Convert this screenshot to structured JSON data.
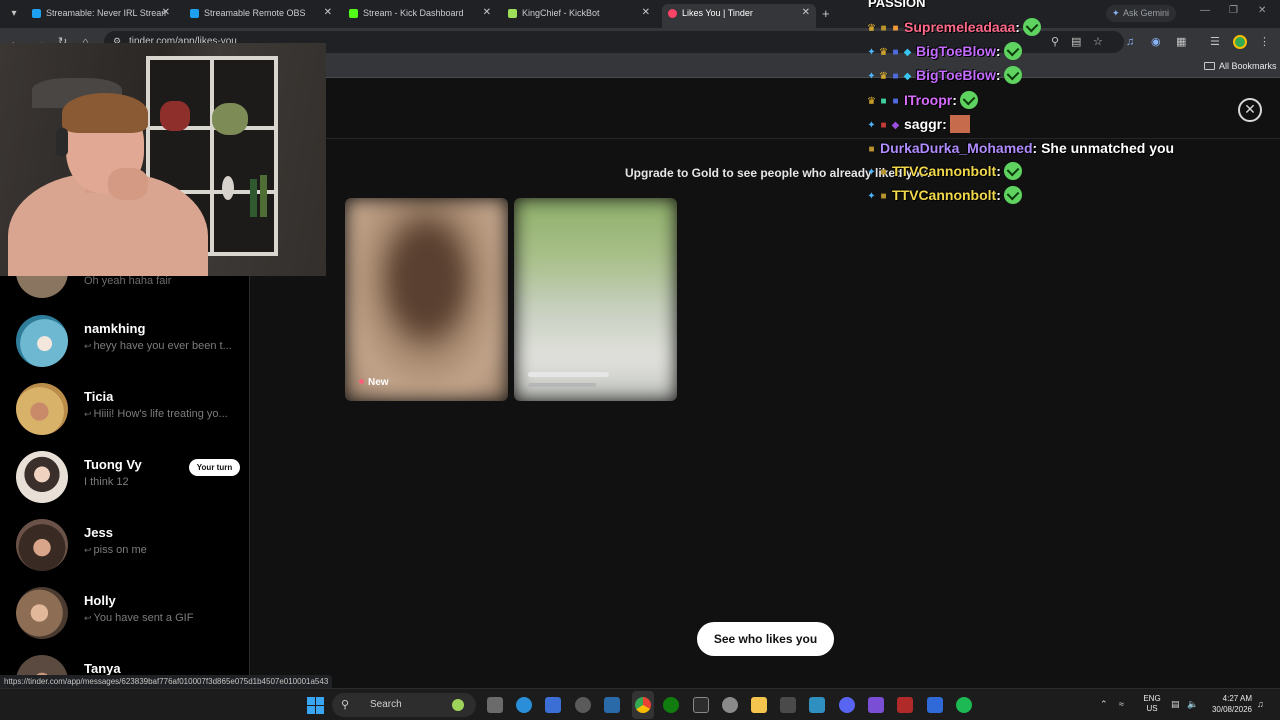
{
  "browser": {
    "tabs": [
      {
        "label": "Streamable: Never IRL Stream W",
        "color": "#1ea0f0"
      },
      {
        "label": "Streamable Remote OBS",
        "color": "#1ea0f0"
      },
      {
        "label": "Stream - Kick Dashboard",
        "color": "#53fc18"
      },
      {
        "label": "KingChief - KickBot",
        "color": "#9ee05a"
      },
      {
        "label": "Likes You | Tinder",
        "color": "#fd4466",
        "active": true
      }
    ],
    "ask_gemini": "Ask Gemini",
    "url": "tinder.com/app/likes-you",
    "bookmarks_label": "All Bookmarks",
    "status_url": "https://tinder.com/app/messages/623839baf776af010007f3d865e075d1b4507e010001a543"
  },
  "sidebar": {
    "partial_message": "Oh yeah haha fair",
    "messages": [
      {
        "name": "namkhing",
        "preview": "heyy have you ever been t...",
        "replied": true,
        "avatar_color": "#6fb8d2"
      },
      {
        "name": "Ticia",
        "preview": "Hiiii! How's life treating yo...",
        "replied": true,
        "avatar_color": "#d9b26a"
      },
      {
        "name": "Tuong Vy",
        "preview": "I think 12",
        "replied": false,
        "badge": "Your turn",
        "avatar_color": "#e8e0d6"
      },
      {
        "name": "Jess",
        "preview": "piss on me",
        "replied": true,
        "avatar_color": "#4b3b34"
      },
      {
        "name": "Holly",
        "preview": "You have sent a GIF",
        "replied": true,
        "avatar_color": "#8d6e55"
      },
      {
        "name": "Tanya",
        "preview": "",
        "replied": false,
        "avatar_color": "#5a4a40"
      }
    ]
  },
  "main": {
    "upgrade_text": "Upgrade to Gold to see people who already liked you.",
    "new_label": "New",
    "see_who_button": "See who likes you",
    "close_icon": "close-icon"
  },
  "chat": {
    "header": "PASSION",
    "lines": [
      {
        "user": "Supremeleadaaa",
        "color": "#ff6a8a",
        "text": "",
        "emote": "check"
      },
      {
        "user": "BigToeBlow",
        "color": "#c46cff",
        "text": "",
        "emote": "check"
      },
      {
        "user": "BigToeBlow",
        "color": "#c46cff",
        "text": "",
        "emote": "check"
      },
      {
        "user": "ITroopr",
        "color": "#d86cff",
        "text": "",
        "emote": "check"
      },
      {
        "user": "saggr",
        "color": "#ffffff",
        "text": "",
        "emote": "face"
      },
      {
        "user": "DurkaDurka_Mohamed",
        "color": "#b08cff",
        "text": "She unmatched you",
        "emote": ""
      },
      {
        "user": "TTVCannonbolt",
        "color": "#f2d94c",
        "text": "",
        "emote": "check"
      },
      {
        "user": "TTVCannonbolt",
        "color": "#f2d94c",
        "text": "",
        "emote": "check"
      }
    ]
  },
  "taskbar": {
    "search_label": "Search",
    "lang_top": "ENG",
    "lang_bottom": "US",
    "time": "4:27 AM",
    "date": "30/08/2026"
  }
}
